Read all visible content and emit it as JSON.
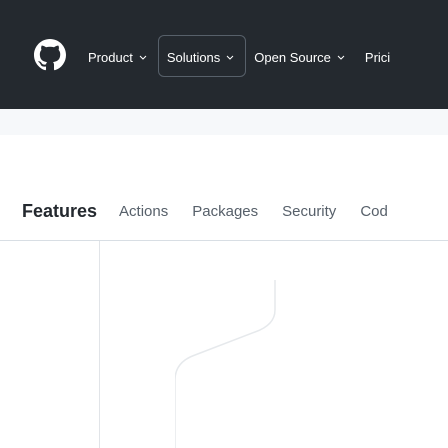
{
  "header": {
    "logo_icon": "github-mark-icon",
    "nav": [
      {
        "label": "Product",
        "has_dropdown": true
      },
      {
        "label": "Solutions",
        "has_dropdown": true
      },
      {
        "label": "Open Source",
        "has_dropdown": true
      },
      {
        "label": "Prici",
        "has_dropdown": false
      }
    ],
    "colors": {
      "background": "#24292f",
      "text": "#ffffff"
    }
  },
  "subnav": {
    "title": "Features",
    "items": [
      "Actions",
      "Packages",
      "Security",
      "Cod"
    ]
  }
}
